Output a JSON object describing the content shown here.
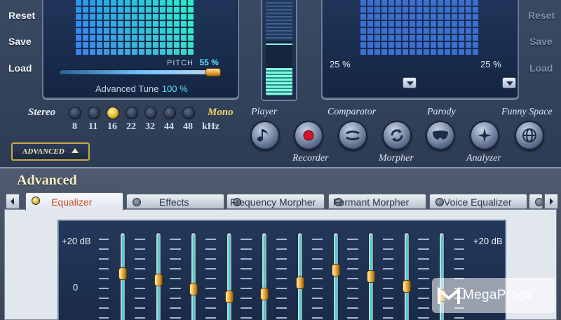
{
  "left_buttons": [
    "Reset",
    "Save",
    "Load"
  ],
  "right_buttons": [
    "Reset",
    "Save",
    "Load"
  ],
  "pitch": {
    "label": "PITCH",
    "value": "55 %",
    "level": 0.95
  },
  "advanced_tune": {
    "label": "Advanced Tune",
    "value": "100 %"
  },
  "right_panel": {
    "left_pct": "25 %",
    "right_pct": "25 %"
  },
  "center_meter": {
    "level": 0.28
  },
  "stereo_label": "Stereo",
  "mono_label": "Mono",
  "sample_rates": [
    "8",
    "11",
    "16",
    "22",
    "32",
    "44",
    "48"
  ],
  "sample_rate_unit": "kHz",
  "selected_rate_index": 2,
  "modules_top": [
    "Player",
    "Comparator",
    "Parody",
    "Funny Space"
  ],
  "modules_bottom": [
    "Recorder",
    "Morpher",
    "Analyzer"
  ],
  "advanced_toggle": "ADVANCED",
  "section_title": "Advanced",
  "tabs": [
    "Equalizer",
    "Effects",
    "Frequency Morpher",
    "Formant Morpher",
    "Voice Equalizer"
  ],
  "active_tab": "Equalizer",
  "equalizer": {
    "db_top_left": "+20 dB",
    "db_top_right": "+20 dB",
    "db_mid": "0",
    "bands": [
      0.45,
      0.55,
      0.7,
      0.82,
      0.78,
      0.6,
      0.4,
      0.5,
      0.66,
      0.8
    ]
  },
  "watermark": "MegaProgz",
  "colors": {
    "accent": "#5fe0ff",
    "meter": "#7ff7e3",
    "knob": "#e7a83a",
    "active_tab_text": "#d4502c"
  }
}
